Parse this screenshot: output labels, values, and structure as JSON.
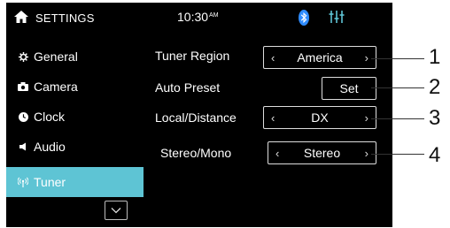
{
  "status": {
    "title": "SETTINGS",
    "time": "10:30",
    "ampm": "AM"
  },
  "sidebar": {
    "items": [
      {
        "label": "General",
        "icon": "gear-icon"
      },
      {
        "label": "Camera",
        "icon": "camera-icon"
      },
      {
        "label": "Clock",
        "icon": "clock-icon"
      },
      {
        "label": "Audio",
        "icon": "speaker-icon"
      },
      {
        "label": "Tuner",
        "icon": "antenna-icon",
        "active": true
      }
    ]
  },
  "settings": {
    "tuner_region": {
      "label": "Tuner Region",
      "value": "America"
    },
    "auto_preset": {
      "label": "Auto Preset",
      "button": "Set"
    },
    "local_distance": {
      "label": "Local/Distance",
      "value": "DX"
    },
    "stereo_mono": {
      "label": "Stereo/Mono",
      "value": "Stereo"
    }
  },
  "callouts": [
    "1",
    "2",
    "3",
    "4"
  ],
  "colors": {
    "accent": "#5ec4d4",
    "background": "#000000",
    "bluetooth": "#2f8cff"
  }
}
